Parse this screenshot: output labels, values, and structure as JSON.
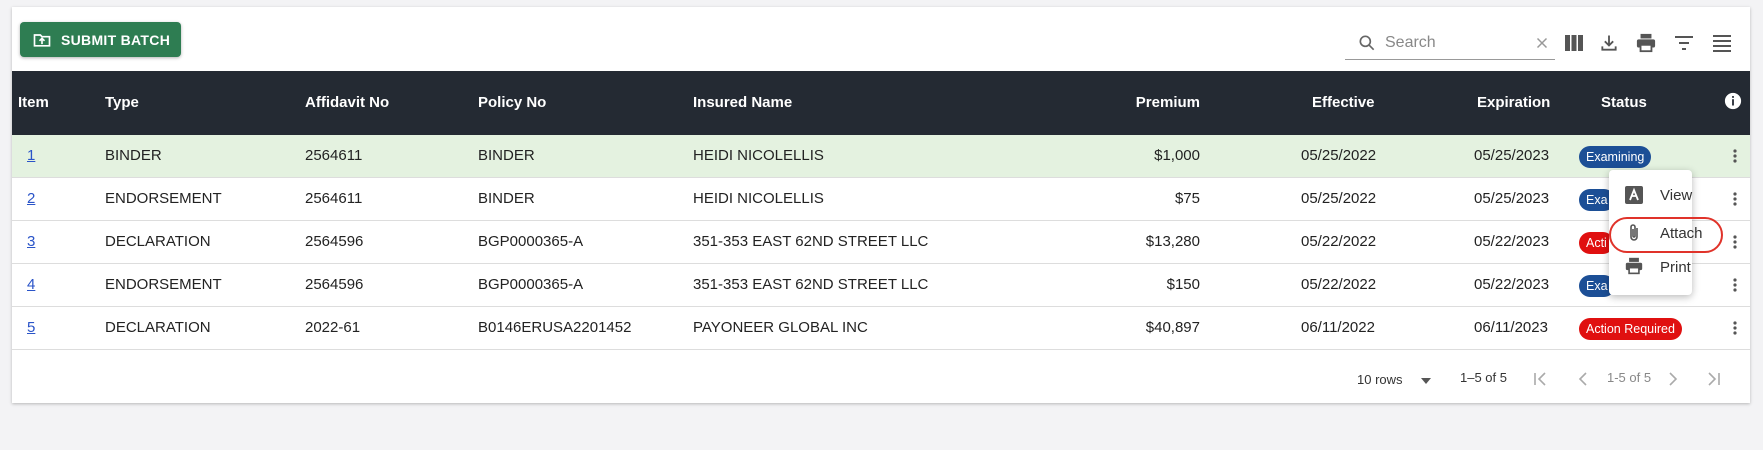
{
  "toolbar": {
    "submit_label": "SUBMIT BATCH",
    "search_placeholder": "Search",
    "icons": [
      "columns-icon",
      "download-icon",
      "print-icon",
      "filter-icon",
      "view-list-icon"
    ]
  },
  "table": {
    "headers": {
      "item": "Item",
      "type": "Type",
      "affidavit": "Affidavit No",
      "policy": "Policy No",
      "insured": "Insured Name",
      "premium": "Premium",
      "effective": "Effective",
      "expiration": "Expiration",
      "status": "Status"
    },
    "rows": [
      {
        "item": "1",
        "type": "BINDER",
        "affidavit": "2564611",
        "policy": "BINDER",
        "insured": "HEIDI NICOLELLIS",
        "premium": "$1,000",
        "effective": "05/25/2022",
        "expiration": "05/25/2023",
        "status": "Examining"
      },
      {
        "item": "2",
        "type": "ENDORSEMENT",
        "affidavit": "2564611",
        "policy": "BINDER",
        "insured": "HEIDI NICOLELLIS",
        "premium": "$75",
        "effective": "05/25/2022",
        "expiration": "05/25/2023",
        "status": "Exa"
      },
      {
        "item": "3",
        "type": "DECLARATION",
        "affidavit": "2564596",
        "policy": "BGP0000365-A",
        "insured": "351-353 EAST 62ND STREET LLC",
        "premium": "$13,280",
        "effective": "05/22/2022",
        "expiration": "05/22/2023",
        "status": "Acti"
      },
      {
        "item": "4",
        "type": "ENDORSEMENT",
        "affidavit": "2564596",
        "policy": "BGP0000365-A",
        "insured": "351-353 EAST 62ND STREET LLC",
        "premium": "$150",
        "effective": "05/22/2022",
        "expiration": "05/22/2023",
        "status": "Exa"
      },
      {
        "item": "5",
        "type": "DECLARATION",
        "affidavit": "2022-61",
        "policy": "B0146ERUSA2201452",
        "insured": "PAYONEER GLOBAL INC",
        "premium": "$40,897",
        "effective": "06/11/2022",
        "expiration": "06/11/2023",
        "status": "Action Required"
      }
    ]
  },
  "footer": {
    "rows_per_page": "10 rows",
    "range_label": "1–5 of 5",
    "page_label": "1-5 of 5"
  },
  "context_menu": {
    "items": [
      "View",
      "Attach",
      "Print"
    ]
  },
  "colors": {
    "primary_button": "#2e7d52",
    "header_bg": "#242a33",
    "highlight_row": "#e4f2e0",
    "examining_badge": "#1c4f96",
    "action_badge": "#e01010",
    "focus_ring": "#e0332a"
  }
}
